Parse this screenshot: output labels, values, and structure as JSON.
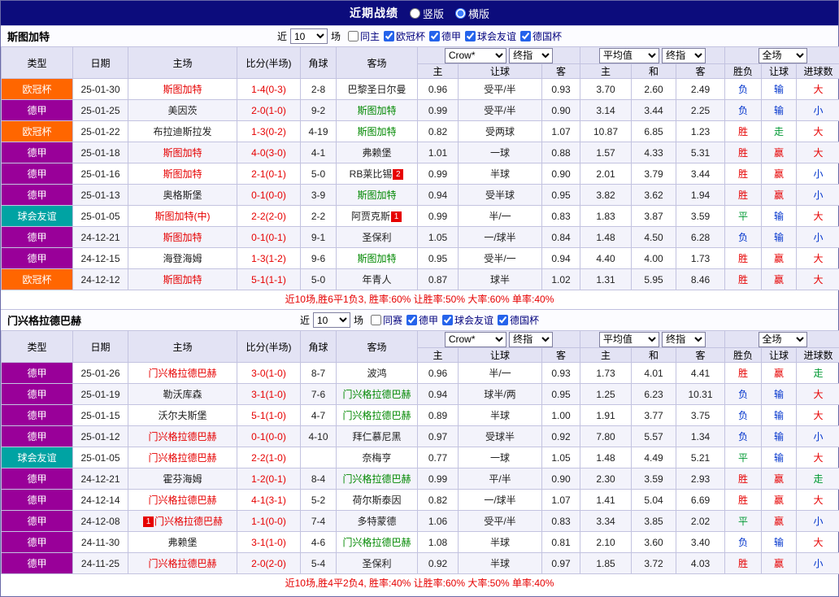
{
  "title_bar": {
    "title": "近期战绩",
    "layout_options": [
      {
        "label": "竖版",
        "selected": false
      },
      {
        "label": "横版",
        "selected": true
      }
    ]
  },
  "filter_labels": {
    "near": "近",
    "games": "场"
  },
  "table_header": {
    "type": "类型",
    "date": "日期",
    "home": "主场",
    "score": "比分(半场)",
    "corner": "角球",
    "away": "客场",
    "odds_source_select": "Crow*",
    "odds_kind_select": "终指",
    "avg_select": "平均值",
    "avg_kind_select": "终指",
    "full_select": "全场",
    "sub_home": "主",
    "sub_handicap": "让球",
    "sub_away": "客",
    "sub_avg_home": "主",
    "sub_avg_draw": "和",
    "sub_avg_away": "客",
    "sub_result": "胜负",
    "sub_handicap_result": "让球",
    "sub_goals": "进球数"
  },
  "colors": {
    "type_colors": {
      "欧冠杯": "#ff6600",
      "德甲": "#990099",
      "球会友谊": "#00a3a3"
    },
    "team_colors": {
      "red": "#e60000",
      "green": "#008800",
      "black": "#222222"
    },
    "result_colors": {
      "胜": "#e60000",
      "赢": "#e60000",
      "大": "#e60000",
      "负": "#0033cc",
      "输": "#0033cc",
      "小": "#0033cc",
      "平": "#009933",
      "走": "#009933"
    },
    "score_color": "#e60000"
  },
  "sections": [
    {
      "team": "斯图加特",
      "near_count": "10",
      "checkboxes": [
        {
          "label": "同主",
          "checked": false
        },
        {
          "label": "欧冠杯",
          "checked": true
        },
        {
          "label": "德甲",
          "checked": true
        },
        {
          "label": "球会友谊",
          "checked": true
        },
        {
          "label": "德国杯",
          "checked": true
        }
      ],
      "rows": [
        {
          "type": "欧冠杯",
          "date": "25-01-30",
          "home": "斯图加特",
          "home_color": "red",
          "home_card": "",
          "score": "1-4(0-3)",
          "corners": "2-8",
          "away": "巴黎圣日尔曼",
          "away_color": "black",
          "away_card": "",
          "odds_home": "0.96",
          "handicap": "受平/半",
          "odds_away": "0.93",
          "avg_home": "3.70",
          "avg_draw": "2.60",
          "avg_away": "2.49",
          "result": "负",
          "handicap_result": "输",
          "goals_result": "大"
        },
        {
          "type": "德甲",
          "date": "25-01-25",
          "home": "美因茨",
          "home_color": "black",
          "home_card": "",
          "score": "2-0(1-0)",
          "corners": "9-2",
          "away": "斯图加特",
          "away_color": "green",
          "away_card": "",
          "odds_home": "0.99",
          "handicap": "受平/半",
          "odds_away": "0.90",
          "avg_home": "3.14",
          "avg_draw": "3.44",
          "avg_away": "2.25",
          "result": "负",
          "handicap_result": "输",
          "goals_result": "小"
        },
        {
          "type": "欧冠杯",
          "date": "25-01-22",
          "home": "布拉迪斯拉发",
          "home_color": "black",
          "home_card": "",
          "score": "1-3(0-2)",
          "corners": "4-19",
          "away": "斯图加特",
          "away_color": "green",
          "away_card": "",
          "odds_home": "0.82",
          "handicap": "受两球",
          "odds_away": "1.07",
          "avg_home": "10.87",
          "avg_draw": "6.85",
          "avg_away": "1.23",
          "result": "胜",
          "handicap_result": "走",
          "goals_result": "大"
        },
        {
          "type": "德甲",
          "date": "25-01-18",
          "home": "斯图加特",
          "home_color": "red",
          "home_card": "",
          "score": "4-0(3-0)",
          "corners": "4-1",
          "away": "弗赖堡",
          "away_color": "black",
          "away_card": "",
          "odds_home": "1.01",
          "handicap": "一球",
          "odds_away": "0.88",
          "avg_home": "1.57",
          "avg_draw": "4.33",
          "avg_away": "5.31",
          "result": "胜",
          "handicap_result": "赢",
          "goals_result": "大"
        },
        {
          "type": "德甲",
          "date": "25-01-16",
          "home": "斯图加特",
          "home_color": "red",
          "home_card": "",
          "score": "2-1(0-1)",
          "corners": "5-0",
          "away": "RB莱比锡",
          "away_color": "black",
          "away_card": "2",
          "odds_home": "0.99",
          "handicap": "半球",
          "odds_away": "0.90",
          "avg_home": "2.01",
          "avg_draw": "3.79",
          "avg_away": "3.44",
          "result": "胜",
          "handicap_result": "赢",
          "goals_result": "小"
        },
        {
          "type": "德甲",
          "date": "25-01-13",
          "home": "奥格斯堡",
          "home_color": "black",
          "home_card": "",
          "score": "0-1(0-0)",
          "corners": "3-9",
          "away": "斯图加特",
          "away_color": "green",
          "away_card": "",
          "odds_home": "0.94",
          "handicap": "受半球",
          "odds_away": "0.95",
          "avg_home": "3.82",
          "avg_draw": "3.62",
          "avg_away": "1.94",
          "result": "胜",
          "handicap_result": "赢",
          "goals_result": "小"
        },
        {
          "type": "球会友谊",
          "date": "25-01-05",
          "home": "斯图加特(中)",
          "home_color": "red",
          "home_card": "",
          "score": "2-2(2-0)",
          "corners": "2-2",
          "away": "阿贾克斯",
          "away_color": "black",
          "away_card": "1",
          "odds_home": "0.99",
          "handicap": "半/一",
          "odds_away": "0.83",
          "avg_home": "1.83",
          "avg_draw": "3.87",
          "avg_away": "3.59",
          "result": "平",
          "handicap_result": "输",
          "goals_result": "大"
        },
        {
          "type": "德甲",
          "date": "24-12-21",
          "home": "斯图加特",
          "home_color": "red",
          "home_card": "",
          "score": "0-1(0-1)",
          "corners": "9-1",
          "away": "圣保利",
          "away_color": "black",
          "away_card": "",
          "odds_home": "1.05",
          "handicap": "一/球半",
          "odds_away": "0.84",
          "avg_home": "1.48",
          "avg_draw": "4.50",
          "avg_away": "6.28",
          "result": "负",
          "handicap_result": "输",
          "goals_result": "小"
        },
        {
          "type": "德甲",
          "date": "24-12-15",
          "home": "海登海姆",
          "home_color": "black",
          "home_card": "",
          "score": "1-3(1-2)",
          "corners": "9-6",
          "away": "斯图加特",
          "away_color": "green",
          "away_card": "",
          "odds_home": "0.95",
          "handicap": "受半/一",
          "odds_away": "0.94",
          "avg_home": "4.40",
          "avg_draw": "4.00",
          "avg_away": "1.73",
          "result": "胜",
          "handicap_result": "赢",
          "goals_result": "大"
        },
        {
          "type": "欧冠杯",
          "date": "24-12-12",
          "home": "斯图加特",
          "home_color": "red",
          "home_card": "",
          "score": "5-1(1-1)",
          "corners": "5-0",
          "away": "年青人",
          "away_color": "black",
          "away_card": "",
          "odds_home": "0.87",
          "handicap": "球半",
          "odds_away": "1.02",
          "avg_home": "1.31",
          "avg_draw": "5.95",
          "avg_away": "8.46",
          "result": "胜",
          "handicap_result": "赢",
          "goals_result": "大"
        }
      ],
      "summary": "近10场,胜6平1负3, 胜率:60% 让胜率:50% 大率:60% 单率:40%"
    },
    {
      "team": "门兴格拉德巴赫",
      "near_count": "10",
      "checkboxes": [
        {
          "label": "同赛",
          "checked": false
        },
        {
          "label": "德甲",
          "checked": true
        },
        {
          "label": "球会友谊",
          "checked": true
        },
        {
          "label": "德国杯",
          "checked": true
        }
      ],
      "rows": [
        {
          "type": "德甲",
          "date": "25-01-26",
          "home": "门兴格拉德巴赫",
          "home_color": "red",
          "home_card": "",
          "score": "3-0(1-0)",
          "corners": "8-7",
          "away": "波鸿",
          "away_color": "black",
          "away_card": "",
          "odds_home": "0.96",
          "handicap": "半/一",
          "odds_away": "0.93",
          "avg_home": "1.73",
          "avg_draw": "4.01",
          "avg_away": "4.41",
          "result": "胜",
          "handicap_result": "赢",
          "goals_result": "走"
        },
        {
          "type": "德甲",
          "date": "25-01-19",
          "home": "勒沃库森",
          "home_color": "black",
          "home_card": "",
          "score": "3-1(1-0)",
          "corners": "7-6",
          "away": "门兴格拉德巴赫",
          "away_color": "green",
          "away_card": "",
          "odds_home": "0.94",
          "handicap": "球半/两",
          "odds_away": "0.95",
          "avg_home": "1.25",
          "avg_draw": "6.23",
          "avg_away": "10.31",
          "result": "负",
          "handicap_result": "输",
          "goals_result": "大"
        },
        {
          "type": "德甲",
          "date": "25-01-15",
          "home": "沃尔夫斯堡",
          "home_color": "black",
          "home_card": "",
          "score": "5-1(1-0)",
          "corners": "4-7",
          "away": "门兴格拉德巴赫",
          "away_color": "green",
          "away_card": "",
          "odds_home": "0.89",
          "handicap": "半球",
          "odds_away": "1.00",
          "avg_home": "1.91",
          "avg_draw": "3.77",
          "avg_away": "3.75",
          "result": "负",
          "handicap_result": "输",
          "goals_result": "大"
        },
        {
          "type": "德甲",
          "date": "25-01-12",
          "home": "门兴格拉德巴赫",
          "home_color": "red",
          "home_card": "",
          "score": "0-1(0-0)",
          "corners": "4-10",
          "away": "拜仁慕尼黑",
          "away_color": "black",
          "away_card": "",
          "odds_home": "0.97",
          "handicap": "受球半",
          "odds_away": "0.92",
          "avg_home": "7.80",
          "avg_draw": "5.57",
          "avg_away": "1.34",
          "result": "负",
          "handicap_result": "输",
          "goals_result": "小"
        },
        {
          "type": "球会友谊",
          "date": "25-01-05",
          "home": "门兴格拉德巴赫",
          "home_color": "red",
          "home_card": "",
          "score": "2-2(1-0)",
          "corners": "",
          "away": "奈梅亨",
          "away_color": "black",
          "away_card": "",
          "odds_home": "0.77",
          "handicap": "一球",
          "odds_away": "1.05",
          "avg_home": "1.48",
          "avg_draw": "4.49",
          "avg_away": "5.21",
          "result": "平",
          "handicap_result": "输",
          "goals_result": "大"
        },
        {
          "type": "德甲",
          "date": "24-12-21",
          "home": "霍芬海姆",
          "home_color": "black",
          "home_card": "",
          "score": "1-2(0-1)",
          "corners": "8-4",
          "away": "门兴格拉德巴赫",
          "away_color": "green",
          "away_card": "",
          "odds_home": "0.99",
          "handicap": "平/半",
          "odds_away": "0.90",
          "avg_home": "2.30",
          "avg_draw": "3.59",
          "avg_away": "2.93",
          "result": "胜",
          "handicap_result": "赢",
          "goals_result": "走"
        },
        {
          "type": "德甲",
          "date": "24-12-14",
          "home": "门兴格拉德巴赫",
          "home_color": "red",
          "home_card": "",
          "score": "4-1(3-1)",
          "corners": "5-2",
          "away": "荷尔斯泰因",
          "away_color": "black",
          "away_card": "",
          "odds_home": "0.82",
          "handicap": "一/球半",
          "odds_away": "1.07",
          "avg_home": "1.41",
          "avg_draw": "5.04",
          "avg_away": "6.69",
          "result": "胜",
          "handicap_result": "赢",
          "goals_result": "大"
        },
        {
          "type": "德甲",
          "date": "24-12-08",
          "home": "门兴格拉德巴赫",
          "home_color": "red",
          "home_card": "1",
          "score": "1-1(0-0)",
          "corners": "7-4",
          "away": "多特蒙德",
          "away_color": "black",
          "away_card": "",
          "odds_home": "1.06",
          "handicap": "受平/半",
          "odds_away": "0.83",
          "avg_home": "3.34",
          "avg_draw": "3.85",
          "avg_away": "2.02",
          "result": "平",
          "handicap_result": "赢",
          "goals_result": "小"
        },
        {
          "type": "德甲",
          "date": "24-11-30",
          "home": "弗赖堡",
          "home_color": "black",
          "home_card": "",
          "score": "3-1(1-0)",
          "corners": "4-6",
          "away": "门兴格拉德巴赫",
          "away_color": "green",
          "away_card": "",
          "odds_home": "1.08",
          "handicap": "半球",
          "odds_away": "0.81",
          "avg_home": "2.10",
          "avg_draw": "3.60",
          "avg_away": "3.40",
          "result": "负",
          "handicap_result": "输",
          "goals_result": "大"
        },
        {
          "type": "德甲",
          "date": "24-11-25",
          "home": "门兴格拉德巴赫",
          "home_color": "red",
          "home_card": "",
          "score": "2-0(2-0)",
          "corners": "5-4",
          "away": "圣保利",
          "away_color": "black",
          "away_card": "",
          "odds_home": "0.92",
          "handicap": "半球",
          "odds_away": "0.97",
          "avg_home": "1.85",
          "avg_draw": "3.72",
          "avg_away": "4.03",
          "result": "胜",
          "handicap_result": "赢",
          "goals_result": "小"
        }
      ],
      "summary": "近10场,胜4平2负4, 胜率:40% 让胜率:60% 大率:50% 单率:40%"
    }
  ]
}
